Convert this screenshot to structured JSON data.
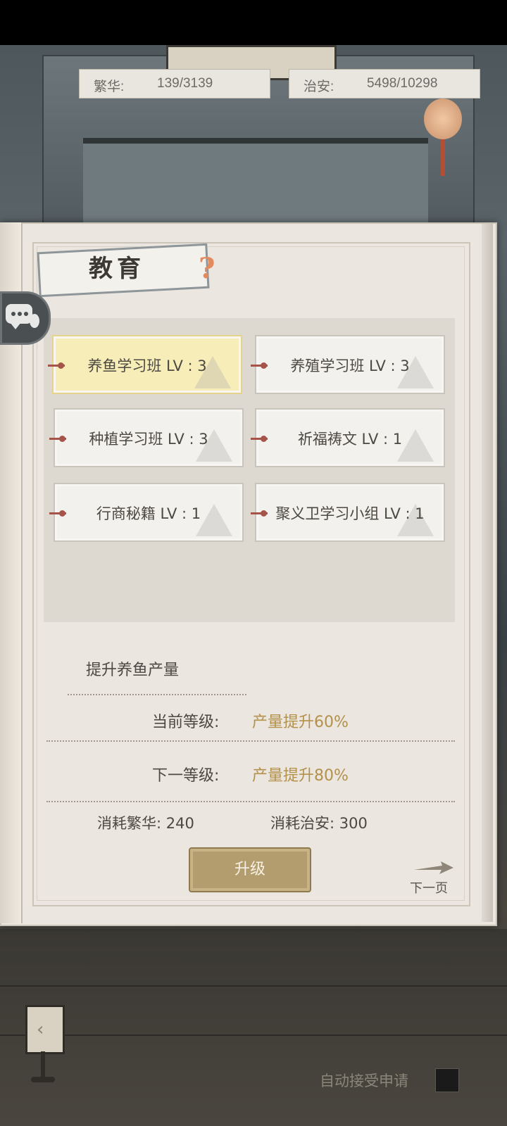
{
  "stats": {
    "prosperity_label": "繁华:",
    "prosperity_value": "139/3139",
    "security_label": "治安:",
    "security_value": "5498/10298"
  },
  "panel": {
    "title": "教育",
    "help_icon": "question-icon",
    "chat_icon": "chat-icon"
  },
  "skills": [
    {
      "label": "养鱼学习班 LV : 3",
      "active": true
    },
    {
      "label": "养殖学习班 LV : 3",
      "active": false
    },
    {
      "label": "种植学习班 LV : 3",
      "active": false
    },
    {
      "label": "祈福祷文 LV : 1",
      "active": false
    },
    {
      "label": "行商秘籍 LV : 1",
      "active": false
    },
    {
      "label": "聚义卫学习小组 LV : 1",
      "active": false
    }
  ],
  "detail": {
    "description": "提升养鱼产量",
    "current_level_label": "当前等级:",
    "current_level_value": "产量提升60%",
    "next_level_label": "下一等级:",
    "next_level_value": "产量提升80%",
    "cost_prosperity": "消耗繁华:  240",
    "cost_security": "消耗治安:  300",
    "upgrade_button": "升级",
    "next_page": "下一页"
  },
  "footer": {
    "auto_accept_label": "自动接受申请",
    "auto_accept_checked": false
  },
  "colors": {
    "highlight_value": "#b3914b",
    "active_tab": "#f6edb8",
    "button": "#b39d6e"
  }
}
